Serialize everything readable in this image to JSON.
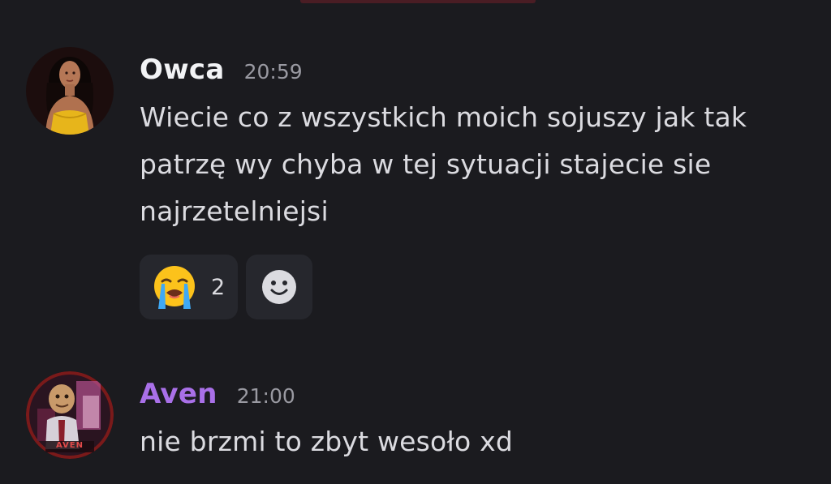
{
  "messages": [
    {
      "username": "Owca",
      "username_color": "#f2f3f5",
      "timestamp": "20:59",
      "text": "Wiecie co z wszystkich moich sojuszy jak tak patrzę wy chyba w tej sytuacji stajecie sie najrzetelniejsi",
      "avatar_icon": "user-avatar-owca",
      "reactions": [
        {
          "emoji": "loudly-crying-face",
          "count": "2"
        }
      ],
      "add_reaction_icon": "smiley-add-reaction-icon"
    },
    {
      "username": "Aven",
      "username_color": "#a970e8",
      "timestamp": "21:00",
      "text": "nie brzmi to zbyt wesoło xd",
      "avatar_icon": "user-avatar-aven",
      "avatar_text": "AVEN"
    }
  ],
  "colors": {
    "background": "#1b1b1f",
    "reaction_bg": "#26272d",
    "text": "#dbdbe0",
    "timestamp": "#9a9aa2"
  }
}
